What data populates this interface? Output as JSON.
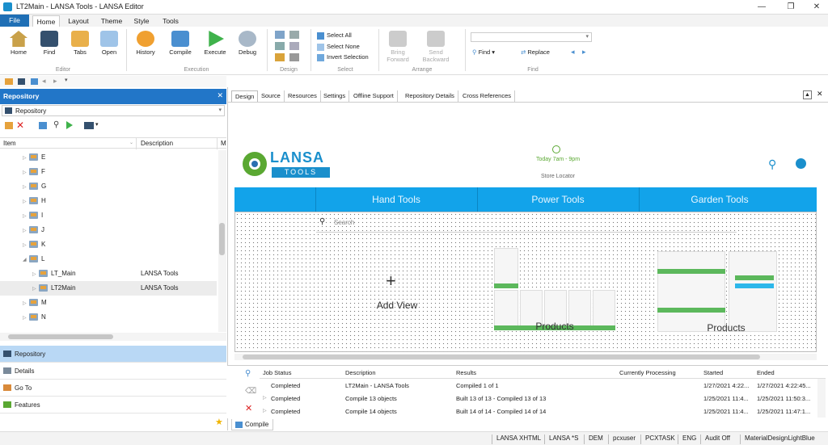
{
  "window": {
    "title": "LT2Main - LANSA Tools - LANSA Editor"
  },
  "menu": {
    "file": "File",
    "tabs": [
      "Home",
      "Layout",
      "Theme",
      "Style",
      "Tools"
    ]
  },
  "ribbon": {
    "editor": {
      "home": "Home",
      "find": "Find",
      "tabs": "Tabs",
      "open": "Open",
      "group": "Editor"
    },
    "execution": {
      "history": "History",
      "compile": "Compile",
      "execute": "Execute",
      "debug": "Debug",
      "group": "Execution"
    },
    "design": {
      "group": "Design"
    },
    "select": {
      "all": "Select All",
      "none": "Select None",
      "invert": "Invert Selection",
      "group": "Select"
    },
    "arrange": {
      "bring": "Bring",
      "bring2": "Forward",
      "send": "Send",
      "send2": "Backward",
      "group": "Arrange"
    },
    "find": {
      "find": "Find",
      "replace": "Replace",
      "group": "Find"
    }
  },
  "repo": {
    "header": "Repository",
    "selected": "Repository",
    "col_item": "Item",
    "col_desc": "Description",
    "col_m": "M",
    "tree": [
      {
        "label": "E",
        "desc": ""
      },
      {
        "label": "F",
        "desc": ""
      },
      {
        "label": "G",
        "desc": ""
      },
      {
        "label": "H",
        "desc": ""
      },
      {
        "label": "I",
        "desc": ""
      },
      {
        "label": "J",
        "desc": ""
      },
      {
        "label": "K",
        "desc": ""
      },
      {
        "label": "L",
        "desc": ""
      },
      {
        "label": "LT_Main",
        "desc": "LANSA Tools"
      },
      {
        "label": "LT2Main",
        "desc": "LANSA Tools"
      },
      {
        "label": "M",
        "desc": ""
      },
      {
        "label": "N",
        "desc": ""
      }
    ]
  },
  "leftnav": [
    "Repository",
    "Details",
    "Go To",
    "Features"
  ],
  "doc_tabs": [
    "Design",
    "Source",
    "Resources",
    "Settings",
    "Offline Support",
    "Repository Details",
    "Cross References"
  ],
  "preview": {
    "logo_top": "LANSA",
    "logo_bottom": "TOOLS",
    "hours": "Today 7am - 9pm",
    "store": "Store Locator",
    "nav": [
      "Hand Tools",
      "Power Tools",
      "Garden Tools"
    ],
    "search": "Search",
    "add_view": "Add View",
    "products1": "Products",
    "products2": "Products"
  },
  "jobs": {
    "headers": [
      "Job Status",
      "Description",
      "Results",
      "Currently Processing",
      "Started",
      "Ended"
    ],
    "rows": [
      [
        "Completed",
        "LT2Main - LANSA Tools",
        "Compiled 1 of 1",
        "",
        "1/27/2021 4:22...",
        "1/27/2021 4:22:45..."
      ],
      [
        "Completed",
        "Compile 13 objects",
        "Built 13 of 13 - Compiled 13 of 13",
        "",
        "1/25/2021 11:4...",
        "1/25/2021 11:50:3..."
      ],
      [
        "Completed",
        "Compile 14 objects",
        "Built 14 of 14 - Compiled 14 of 14",
        "",
        "1/25/2021 11:4...",
        "1/25/2021 11:47:1..."
      ]
    ],
    "tab": "Compile"
  },
  "status": [
    "LANSA XHTML",
    "LANSA *S",
    "DEM",
    "pcxuser",
    "PCXTASK",
    "ENG",
    "Audit Off",
    "MaterialDesignLightBlue"
  ],
  "colors": {
    "accent": "#2276c8",
    "nav": "#12a3ea",
    "green": "#5cb85c",
    "logo_green": "#5aa832"
  }
}
